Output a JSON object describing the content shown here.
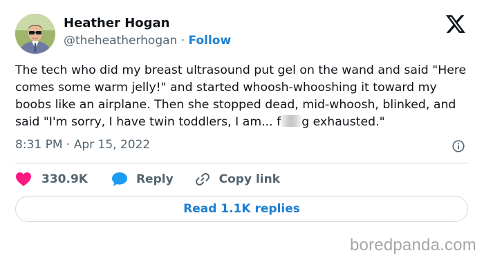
{
  "author": {
    "name": "Heather Hogan",
    "handle": "@theheatherhogan",
    "separator": "·",
    "follow_label": "Follow",
    "avatar_icon": "profile-photo"
  },
  "platform_icon": "x-logo-icon",
  "tweet": {
    "text_before": "The tech who did my breast ultrasound put gel on the wand and said \"Here comes some warm jelly!\" and started whoosh-whooshing it toward my boobs like an airplane. Then she stopped dead, mid-whoosh, blinked, and said \"I'm sorry, I have twin toddlers, I am... f",
    "text_after": "g exhausted.\"",
    "timestamp": "8:31 PM · Apr 15, 2022"
  },
  "actions": {
    "likes": "330.9K",
    "reply_label": "Reply",
    "copy_link_label": "Copy link"
  },
  "read_replies_label": "Read 1.1K replies",
  "watermark": "boredpanda.com",
  "colors": {
    "accent": "#1d7fd1",
    "like": "#f91880",
    "muted": "#536471",
    "text": "#0f1419",
    "border": "#cfd9de"
  }
}
